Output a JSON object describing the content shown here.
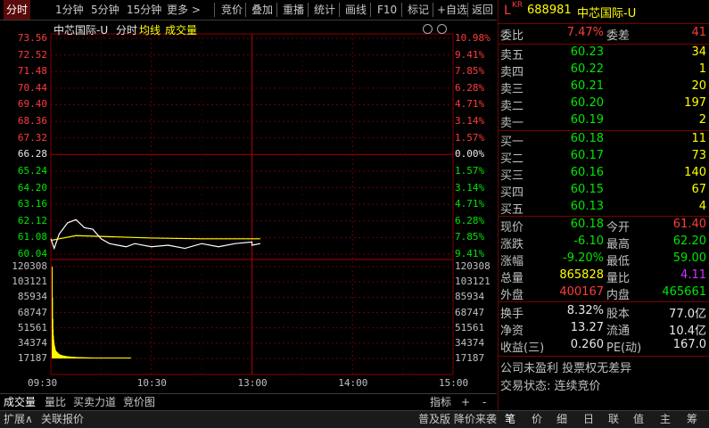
{
  "toolbar": {
    "items": [
      "分时",
      "1分钟",
      "5分钟",
      "15分钟",
      "更多 >",
      "竞价",
      "叠加",
      "重播",
      "统计",
      "画线",
      "F10",
      "标记",
      "+自选",
      "返回"
    ]
  },
  "chart": {
    "title": "中芯国际-U",
    "mode_label": "分时",
    "avg_label": "均线",
    "vol_label": "成交量",
    "price_ticks_left": [
      "73.56",
      "72.52",
      "71.48",
      "70.44",
      "69.40",
      "68.36",
      "67.32",
      "66.28",
      "65.24",
      "64.20",
      "63.16",
      "62.12",
      "61.08",
      "60.04"
    ],
    "price_ticks_right": [
      "10.98%",
      "9.41%",
      "7.85%",
      "6.28%",
      "4.71%",
      "3.14%",
      "1.57%",
      "0.00%",
      "1.57%",
      "3.14%",
      "4.71%",
      "6.28%",
      "7.85%",
      "9.41%"
    ],
    "vol_ticks": [
      "120308",
      "103121",
      "85934",
      "68747",
      "51561",
      "34374",
      "17187"
    ],
    "time_ticks": [
      "09:30",
      "10:30",
      "13:00",
      "14:00",
      "15:00"
    ],
    "colors": {
      "up": "#ff3b3b",
      "down": "#00e600",
      "price_line": "#ffffff",
      "avg_line": "#ffff00",
      "volume": "#ffff00",
      "grid": "#8b0000"
    }
  },
  "chart_data": {
    "type": "line",
    "title": "中芯国际-U",
    "xlabel": "",
    "ylabel": "",
    "x_range": [
      "09:30",
      "15:00"
    ],
    "ylim": [
      60.04,
      73.56
    ],
    "prev_close": 66.28,
    "series": [
      {
        "name": "分时",
        "x": [
          "09:30",
          "09:32",
          "09:35",
          "09:40",
          "09:45",
          "09:50",
          "09:55",
          "10:00",
          "10:05",
          "10:10",
          "10:15",
          "10:20",
          "10:30",
          "10:40",
          "10:50",
          "11:00",
          "11:10",
          "11:20",
          "11:30",
          "13:00",
          "13:05"
        ],
        "values": [
          61.0,
          60.4,
          61.3,
          62.0,
          62.2,
          61.7,
          61.6,
          61.0,
          60.7,
          60.6,
          60.5,
          60.7,
          60.5,
          60.6,
          60.4,
          60.7,
          60.5,
          60.7,
          60.8,
          60.6,
          60.7
        ]
      },
      {
        "name": "均线",
        "x": [
          "09:30",
          "09:35",
          "09:45",
          "10:00",
          "10:30",
          "11:00",
          "11:30",
          "13:05"
        ],
        "values": [
          60.9,
          61.0,
          61.2,
          61.15,
          61.05,
          61.0,
          61.0,
          61.0
        ]
      }
    ],
    "volume": {
      "name": "成交量",
      "ylim": [
        0,
        120308
      ],
      "values": [
        120308,
        80000,
        52000,
        38000,
        30000,
        24000,
        20000,
        17000,
        15000,
        13000,
        11000,
        10000,
        9500,
        9000,
        8000,
        8500,
        7000,
        7500,
        6000,
        6500,
        5500,
        6000,
        5000,
        5200,
        4800,
        5000,
        4500,
        4200,
        4600,
        4000,
        3800,
        4100,
        3600,
        3900,
        3500,
        3300,
        3700,
        3200,
        3000,
        3400,
        2900,
        3100,
        2800,
        3000,
        2700,
        2900,
        2600,
        2800,
        2500,
        2700,
        2400,
        2600,
        2300,
        2500,
        2200,
        2400,
        2100,
        2300,
        2000,
        2200,
        1900,
        2100,
        1800,
        2000,
        1900,
        2100,
        1800,
        2000,
        1700,
        1900,
        1600,
        1800,
        1500,
        1700,
        1600,
        1800,
        1500,
        1700,
        1400,
        1600,
        1500,
        1700,
        1400,
        1600,
        1500,
        1400,
        1600,
        1300,
        1500,
        1400,
        1600,
        1300,
        1500,
        1400,
        1300,
        1500,
        1200,
        1400,
        1300,
        1500,
        1200,
        1400,
        1300,
        1200,
        1400,
        1300,
        1200,
        1400,
        1100,
        1300,
        1200,
        1400,
        1100,
        1300,
        1200,
        1100,
        1300,
        1200,
        1100,
        1300,
        1000,
        1200,
        1100,
        1000,
        1200,
        1100,
        1000,
        1200,
        1100,
        1000,
        1200,
        1100,
        1000,
        1200,
        1100,
        1000,
        1200,
        1100,
        1000,
        1200,
        1100,
        1000,
        1200,
        1100,
        1000,
        1200,
        1100,
        1000,
        1200,
        1100,
        1000,
        1200,
        1100,
        1000,
        1200,
        1100,
        1000,
        1200,
        1100,
        1000,
        1200,
        1100,
        1000,
        1200,
        1100,
        1000,
        1200,
        1100,
        1000,
        1200,
        1100,
        1000,
        1200,
        1100,
        1000,
        1200,
        1100,
        1000,
        1200,
        1100,
        1000,
        1200,
        1100,
        1000,
        1200,
        1100,
        1000,
        1200,
        1100,
        1000,
        1200,
        1100,
        1000,
        1200,
        1100,
        1000,
        1200,
        1100,
        1000,
        1200,
        1100,
        1000,
        1200,
        1100,
        1000,
        1200,
        1100,
        1000,
        1200,
        1100,
        1000,
        1200,
        1100,
        1000,
        1200,
        1100,
        1000,
        1200,
        1100,
        1000,
        1200,
        1100,
        1000,
        1200,
        1100,
        1000,
        1200,
        1100,
        1000,
        1200,
        1100,
        1000,
        1200,
        1100,
        1000
      ]
    },
    "grid": true
  },
  "tabs": [
    "成交量",
    "量比",
    "买卖力道",
    "竞价图"
  ],
  "tab_right": [
    "指标",
    "+",
    "-"
  ],
  "statusbar": {
    "left": [
      "扩展∧",
      "关联报价"
    ],
    "right_label": "普及版 降价来袭",
    "right_tabs": [
      "笔",
      "价",
      "细",
      "日",
      "联",
      "值",
      "主",
      "筹"
    ]
  },
  "panel": {
    "code_prefix": "L",
    "market_sup": "KR",
    "code": "688981",
    "name": "中芯国际-U",
    "weibi_label": "委比",
    "weibi": "7.47%",
    "weicha_label": "委差",
    "weicha": "41",
    "asks": [
      {
        "label": "卖五",
        "price": "60.23",
        "vol": "34"
      },
      {
        "label": "卖四",
        "price": "60.22",
        "vol": "1"
      },
      {
        "label": "卖三",
        "price": "60.21",
        "vol": "20"
      },
      {
        "label": "卖二",
        "price": "60.20",
        "vol": "197"
      },
      {
        "label": "卖一",
        "price": "60.19",
        "vol": "2"
      }
    ],
    "bids": [
      {
        "label": "买一",
        "price": "60.18",
        "vol": "11"
      },
      {
        "label": "买二",
        "price": "60.17",
        "vol": "73"
      },
      {
        "label": "买三",
        "price": "60.16",
        "vol": "140"
      },
      {
        "label": "买四",
        "price": "60.15",
        "vol": "67"
      },
      {
        "label": "买五",
        "price": "60.13",
        "vol": "4"
      }
    ],
    "quote": [
      {
        "l1": "现价",
        "v1": "60.18",
        "l2": "今开",
        "v2": "61.40"
      },
      {
        "l1": "涨跌",
        "v1": "-6.10",
        "l2": "最高",
        "v2": "62.20"
      },
      {
        "l1": "涨幅",
        "v1": "-9.20%",
        "l2": "最低",
        "v2": "59.00"
      },
      {
        "l1": "总量",
        "v1": "865828",
        "l2": "量比",
        "v2": "4.11"
      },
      {
        "l1": "外盘",
        "v1": "400167",
        "l2": "内盘",
        "v2": "465661"
      }
    ],
    "stats": [
      {
        "l1": "换手",
        "v1": "8.32%",
        "l2": "股本",
        "v2": "77.0亿"
      },
      {
        "l1": "净资",
        "v1": "13.27",
        "l2": "流通",
        "v2": "10.4亿"
      },
      {
        "l1": "收益(三)",
        "v1": "0.260",
        "l2": "PE(动)",
        "v2": "167.0"
      }
    ],
    "note1": "公司未盈利 投票权无差异",
    "note2": "交易状态: 连续竞价"
  }
}
